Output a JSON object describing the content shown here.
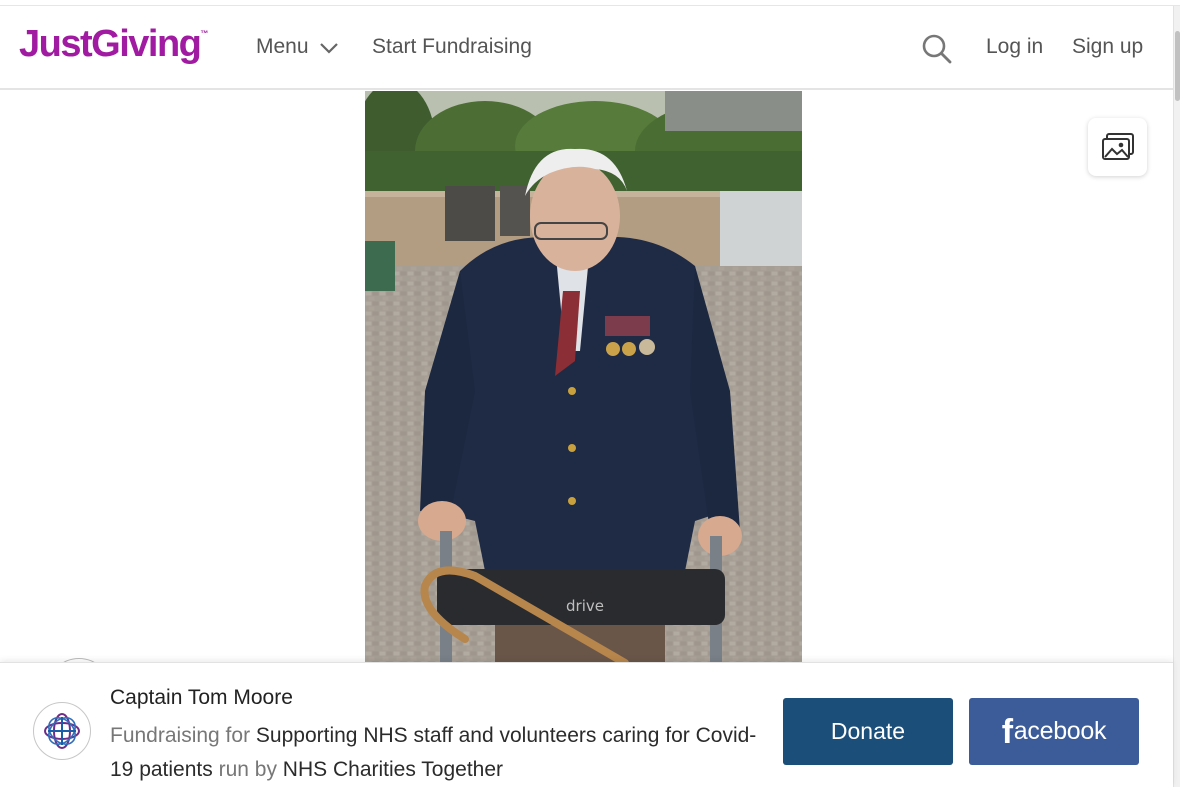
{
  "header": {
    "logo_text": "JustGiving",
    "logo_tm": "™",
    "menu_label": "Menu",
    "start_fundraising": "Start Fundraising",
    "login": "Log in",
    "signup": "Sign up",
    "brand_color": "#a01ba1"
  },
  "icons": {
    "menu_chevron": "chevron-down-icon",
    "search": "search-icon",
    "gallery": "image-gallery-icon",
    "charity": "nhs-charities-logo-icon"
  },
  "photo": {
    "walker_brand": "drive"
  },
  "footer": {
    "fundraiser_name": "Captain Tom Moore",
    "prefix_fundraising": "Fundraising for ",
    "cause": "Supporting NHS staff and volunteers caring for Covid-19 patients",
    "run_by": " run by ",
    "charity": "NHS Charities Together",
    "donate_label": "Donate",
    "facebook_f": "f",
    "facebook_rest": "acebook",
    "donate_color": "#1c4e7a",
    "facebook_color": "#3b5b99"
  }
}
